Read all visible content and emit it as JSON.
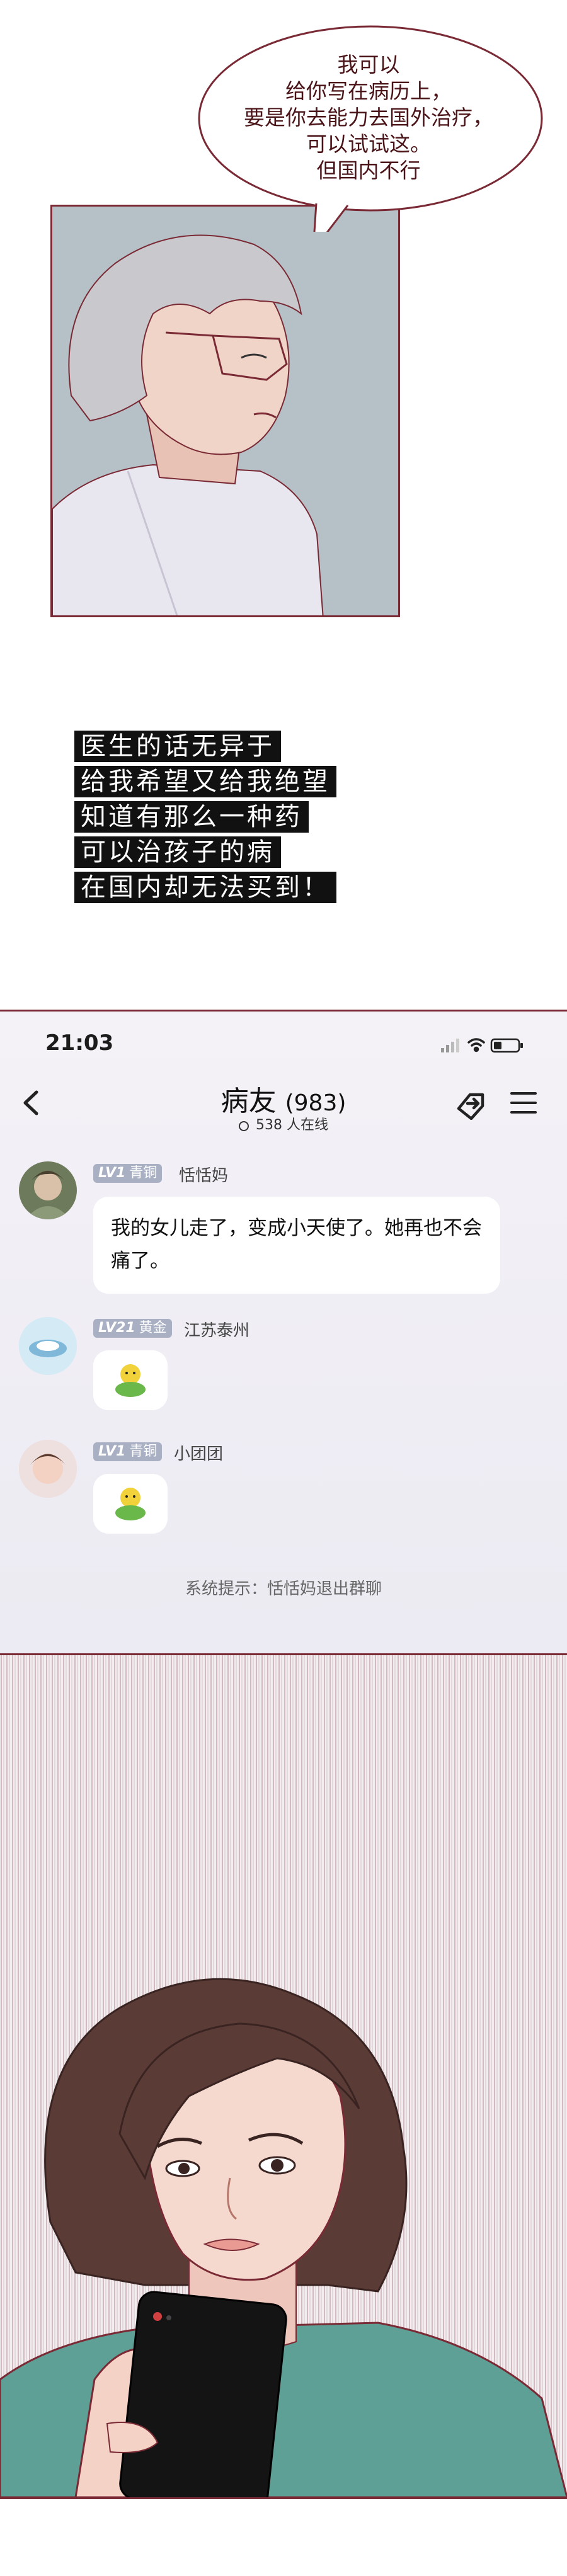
{
  "panel1": {
    "speech_lines": [
      "我可以",
      "给你写在病历上，",
      "要是你去能力去国外治疗，",
      "可以试试这。",
      "但国内不行"
    ]
  },
  "caption": {
    "lines": [
      "医生的话无异于",
      "给我希望又给我绝望",
      "知道有那么一种药",
      "可以治孩子的病",
      "在国内却无法买到！"
    ]
  },
  "phone": {
    "status_time": "21:03",
    "chat_title": "病友",
    "member_count": "(983)",
    "online_text": "538 人在线",
    "messages": [
      {
        "level": "LV1",
        "tier": "青铜",
        "name": "恬恬妈",
        "text": "我的女儿走了，变成小天使了。她再也不会痛了。"
      },
      {
        "level": "LV21",
        "tier": "黄金",
        "name": "江苏泰州",
        "sticker": "hand-sticker-icon"
      },
      {
        "level": "LV1",
        "tier": "青铜",
        "name": "小团团",
        "sticker": "hand-sticker-icon"
      }
    ],
    "system_notice": "系统提示：恬恬妈退出群聊"
  },
  "colors": {
    "border": "#7a2a35",
    "caption_bg": "#111111",
    "level_badge": "#a9b0c4"
  }
}
